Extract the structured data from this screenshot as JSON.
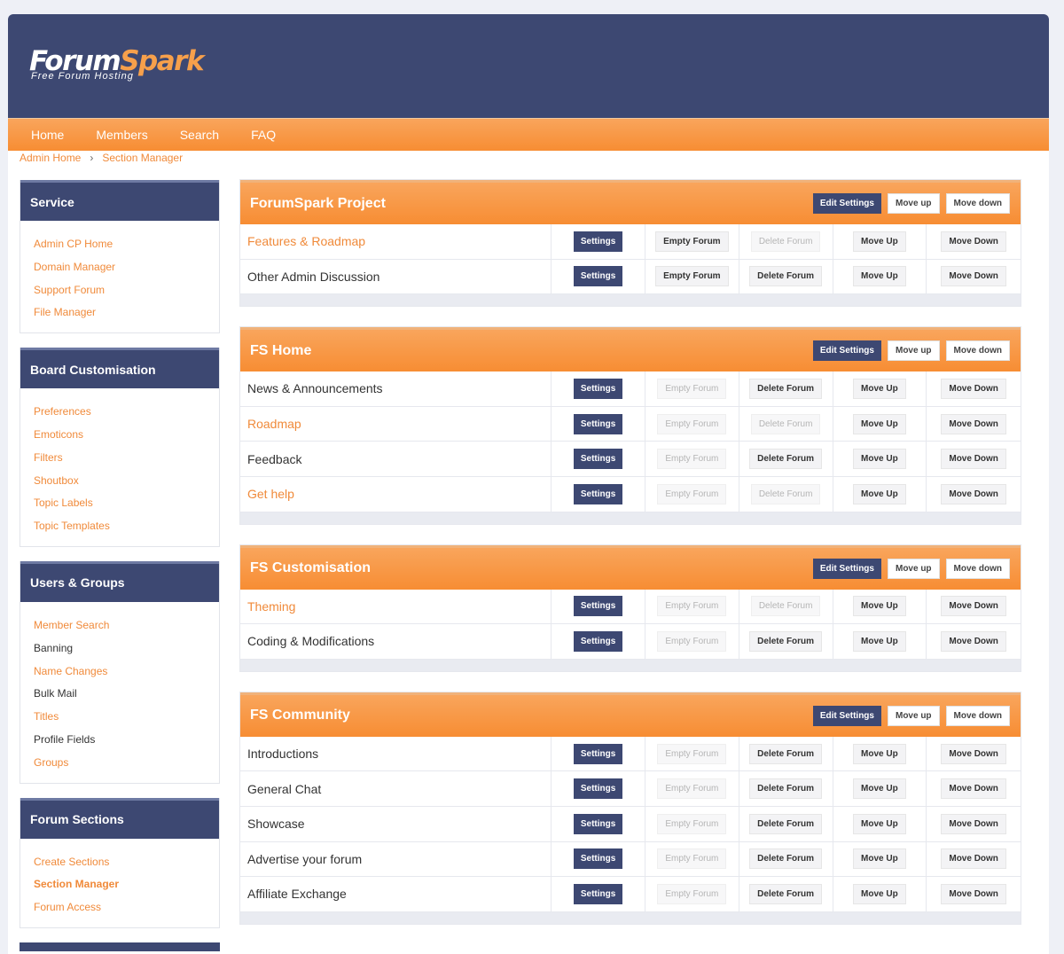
{
  "logo": {
    "word_a": "Forum",
    "word_b": "Spark",
    "tagline": "Free Forum Hosting"
  },
  "nav": [
    "Home",
    "Members",
    "Search",
    "FAQ"
  ],
  "breadcrumb": {
    "home": "Admin Home",
    "sep": "›",
    "current": "Section Manager"
  },
  "sidebar": [
    {
      "title": "Service",
      "items": [
        {
          "label": "Admin CP Home",
          "style": "link"
        },
        {
          "label": "Domain Manager",
          "style": "link"
        },
        {
          "label": "Support Forum",
          "style": "link"
        },
        {
          "label": "File Manager",
          "style": "link"
        }
      ]
    },
    {
      "title": "Board Customisation",
      "items": [
        {
          "label": "Preferences",
          "style": "link"
        },
        {
          "label": "Emoticons",
          "style": "link"
        },
        {
          "label": "Filters",
          "style": "link"
        },
        {
          "label": "Shoutbox",
          "style": "link"
        },
        {
          "label": "Topic Labels",
          "style": "link"
        },
        {
          "label": "Topic Templates",
          "style": "link"
        }
      ]
    },
    {
      "title": "Users & Groups",
      "items": [
        {
          "label": "Member Search",
          "style": "link"
        },
        {
          "label": "Banning",
          "style": "dark"
        },
        {
          "label": "Name Changes",
          "style": "link"
        },
        {
          "label": "Bulk Mail",
          "style": "dark"
        },
        {
          "label": "Titles",
          "style": "link"
        },
        {
          "label": "Profile Fields",
          "style": "dark"
        },
        {
          "label": "Groups",
          "style": "link"
        }
      ]
    },
    {
      "title": "Forum Sections",
      "items": [
        {
          "label": "Create Sections",
          "style": "link"
        },
        {
          "label": "Section Manager",
          "style": "bold"
        },
        {
          "label": "Forum Access",
          "style": "link"
        }
      ]
    }
  ],
  "section_buttons": {
    "edit": "Edit Settings",
    "up": "Move up",
    "down": "Move down"
  },
  "row_buttons": {
    "settings": "Settings",
    "empty": "Empty Forum",
    "delete": "Delete Forum",
    "up": "Move Up",
    "down": "Move Down"
  },
  "sections": [
    {
      "title": "ForumSpark Project",
      "forums": [
        {
          "name": "Features & Roadmap",
          "link": true,
          "empty": true,
          "delete": false
        },
        {
          "name": "Other Admin Discussion",
          "link": false,
          "empty": true,
          "delete": true
        }
      ]
    },
    {
      "title": "FS Home",
      "forums": [
        {
          "name": "News & Announcements",
          "link": false,
          "empty": false,
          "delete": true
        },
        {
          "name": "Roadmap",
          "link": true,
          "empty": false,
          "delete": false
        },
        {
          "name": "Feedback",
          "link": false,
          "empty": false,
          "delete": true
        },
        {
          "name": "Get help",
          "link": true,
          "empty": false,
          "delete": false
        }
      ]
    },
    {
      "title": "FS Customisation",
      "forums": [
        {
          "name": "Theming",
          "link": true,
          "empty": false,
          "delete": false
        },
        {
          "name": "Coding & Modifications",
          "link": false,
          "empty": false,
          "delete": true
        }
      ]
    },
    {
      "title": "FS Community",
      "forums": [
        {
          "name": "Introductions",
          "link": false,
          "empty": false,
          "delete": true
        },
        {
          "name": "General Chat",
          "link": false,
          "empty": false,
          "delete": true
        },
        {
          "name": "Showcase",
          "link": false,
          "empty": false,
          "delete": true
        },
        {
          "name": "Advertise your forum",
          "link": false,
          "empty": false,
          "delete": true
        },
        {
          "name": "Affiliate Exchange",
          "link": false,
          "empty": false,
          "delete": true
        }
      ]
    }
  ]
}
